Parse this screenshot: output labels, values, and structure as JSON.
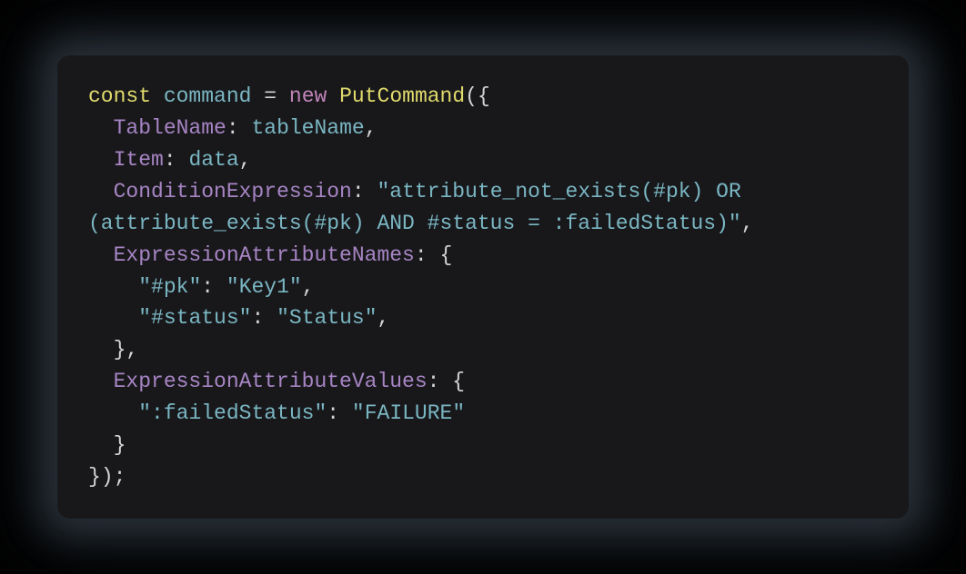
{
  "language": "javascript",
  "code": {
    "keyword_const": "const",
    "var_command": "command",
    "op_eq": "=",
    "keyword_new": "new",
    "class_PutCommand": "PutCommand",
    "open_paren": "(",
    "open_brace": "{",
    "prop_TableName": "TableName",
    "colon": ":",
    "ident_tableName": "tableName",
    "comma": ",",
    "prop_Item": "Item",
    "ident_data": "data",
    "prop_ConditionExpression": "ConditionExpression",
    "str_condition": "attribute_not_exists(#pk) OR (attribute_exists(#pk) AND #status = :failedStatus)",
    "prop_ExpressionAttributeNames": "ExpressionAttributeNames",
    "str_attr_pk_key": "#pk",
    "str_attr_pk_val": "Key1",
    "str_attr_status_key": "#status",
    "str_attr_status_val": "Status",
    "prop_ExpressionAttributeValues": "ExpressionAttributeValues",
    "str_failed_key": ":failedStatus",
    "str_failed_val": "FAILURE",
    "close_brace": "}",
    "close_paren": ")",
    "semicolon": ";",
    "quote": "\""
  }
}
